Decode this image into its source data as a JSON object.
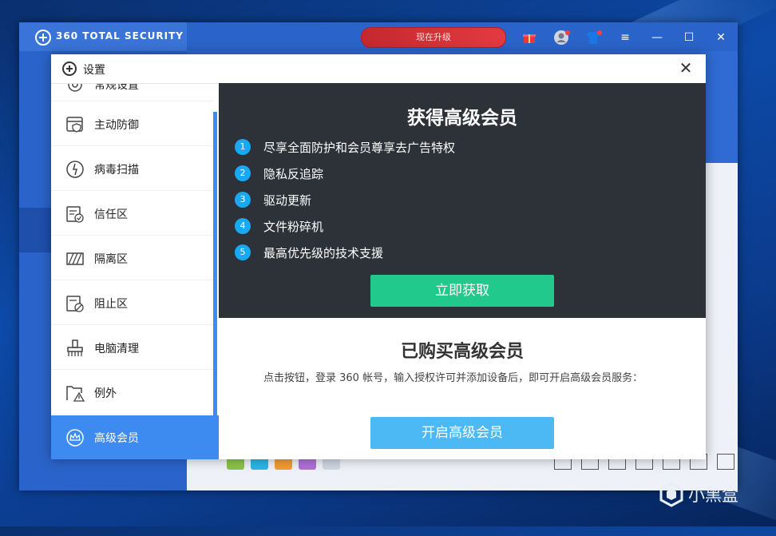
{
  "app": {
    "title": "360 TOTAL SECURITY",
    "upgrade_label": "现在升级",
    "window_controls": {
      "menu": "≡",
      "minimize": "—",
      "maximize": "☐",
      "close": "✕"
    }
  },
  "dialog": {
    "title": "设置",
    "close_label": "✕",
    "nav": {
      "partial_item": "常规设置",
      "items": [
        {
          "label": "主动防御",
          "icon": "active-defense-icon"
        },
        {
          "label": "病毒扫描",
          "icon": "virus-scan-icon"
        },
        {
          "label": "信任区",
          "icon": "trust-zone-icon"
        },
        {
          "label": "隔离区",
          "icon": "quarantine-icon"
        },
        {
          "label": "阻止区",
          "icon": "block-zone-icon"
        },
        {
          "label": "电脑清理",
          "icon": "cleanup-icon"
        },
        {
          "label": "例外",
          "icon": "exception-icon"
        }
      ],
      "active_item": {
        "label": "高级会员",
        "icon": "premium-icon"
      }
    },
    "upsell": {
      "title": "获得高级会员",
      "features": [
        {
          "num": "1",
          "text": "尽享全面防护和会员尊享去广告特权"
        },
        {
          "num": "2",
          "text": "隐私反追踪"
        },
        {
          "num": "3",
          "text": "驱动更新"
        },
        {
          "num": "4",
          "text": "文件粉碎机"
        },
        {
          "num": "5",
          "text": "最高优先级的技术支援"
        }
      ],
      "button_label": "立即获取"
    },
    "purchased": {
      "title": "已购买高级会员",
      "description": "点击按钮，登录 360 帐号，输入授权许可并添加设备后，即可开启高级会员服务：",
      "button_label": "开启高级会员"
    }
  },
  "watermark": {
    "text": "小黑盒"
  },
  "colors": {
    "accent_blue": "#3d8bf0",
    "upsell_bg": "#2d3138",
    "get_button": "#22c98d",
    "open_button": "#4cb9f5",
    "feature_badge": "#19a9f2"
  }
}
